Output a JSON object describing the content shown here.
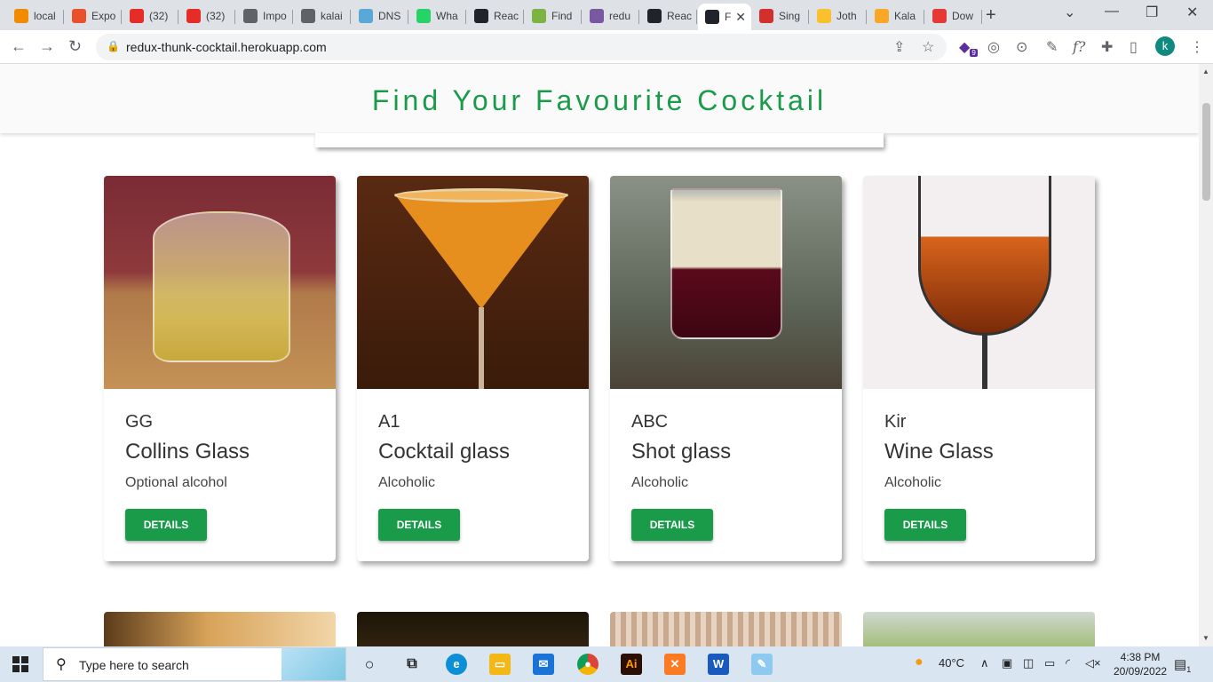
{
  "browser": {
    "tabs": [
      {
        "label": "local",
        "icon": "pma-icon",
        "color": "#f28b00"
      },
      {
        "label": "Expo",
        "icon": "xampp-icon",
        "color": "#e8512a"
      },
      {
        "label": "(32)",
        "icon": "youtube-icon",
        "color": "#e52d27"
      },
      {
        "label": "(32)",
        "icon": "youtube-icon",
        "color": "#e52d27"
      },
      {
        "label": "Impo",
        "icon": "globe-icon",
        "color": "#5f6368"
      },
      {
        "label": "kalai",
        "icon": "globe-icon",
        "color": "#5f6368"
      },
      {
        "label": "DNS",
        "icon": "dns-icon",
        "color": "#5aa8d8"
      },
      {
        "label": "Wha",
        "icon": "whatsapp-icon",
        "color": "#25d366"
      },
      {
        "label": "Reac",
        "icon": "react-icon",
        "color": "#20232a"
      },
      {
        "label": "Find",
        "icon": "find-icon",
        "color": "#7cb342"
      },
      {
        "label": "redu",
        "icon": "heroku-icon",
        "color": "#79589f"
      },
      {
        "label": "Reac",
        "icon": "react-icon",
        "color": "#20232a"
      },
      {
        "label": "F",
        "icon": "react-icon",
        "color": "#20232a",
        "active": true
      },
      {
        "label": "Sing",
        "icon": "sing-icon",
        "color": "#d32f2f"
      },
      {
        "label": "Joth",
        "icon": "joth-icon",
        "color": "#fbc02d"
      },
      {
        "label": "Kala",
        "icon": "cart-icon",
        "color": "#f9a825"
      },
      {
        "label": "Dow",
        "icon": "heart-icon",
        "color": "#e53935"
      }
    ],
    "new_tab_label": "+",
    "url": "redux-thunk-cocktail.herokuapp.com",
    "profile_initial": "k",
    "extension_badge": "9"
  },
  "page": {
    "title": "Find Your Favourite Cocktail",
    "accent_color": "#1a9b4a",
    "cards": [
      {
        "name": "GG",
        "glass": "Collins Glass",
        "alcoholic": "Optional alcohol",
        "button": "DETAILS",
        "image": "collins-glass-drink"
      },
      {
        "name": "A1",
        "glass": "Cocktail glass",
        "alcoholic": "Alcoholic",
        "button": "DETAILS",
        "image": "martini-glass-drink"
      },
      {
        "name": "ABC",
        "glass": "Shot glass",
        "alcoholic": "Alcoholic",
        "button": "DETAILS",
        "image": "layered-shot-drink"
      },
      {
        "name": "Kir",
        "glass": "Wine Glass",
        "alcoholic": "Alcoholic",
        "button": "DETAILS",
        "image": "wine-glass-drink"
      }
    ]
  },
  "taskbar": {
    "search_placeholder": "Type here to search",
    "weather": "40°C",
    "time": "4:38 PM",
    "date": "20/09/2022",
    "notification_count": "1",
    "apps": [
      "task-view",
      "edge",
      "file-explorer",
      "mail",
      "chrome",
      "illustrator",
      "xampp",
      "word",
      "paint"
    ]
  }
}
